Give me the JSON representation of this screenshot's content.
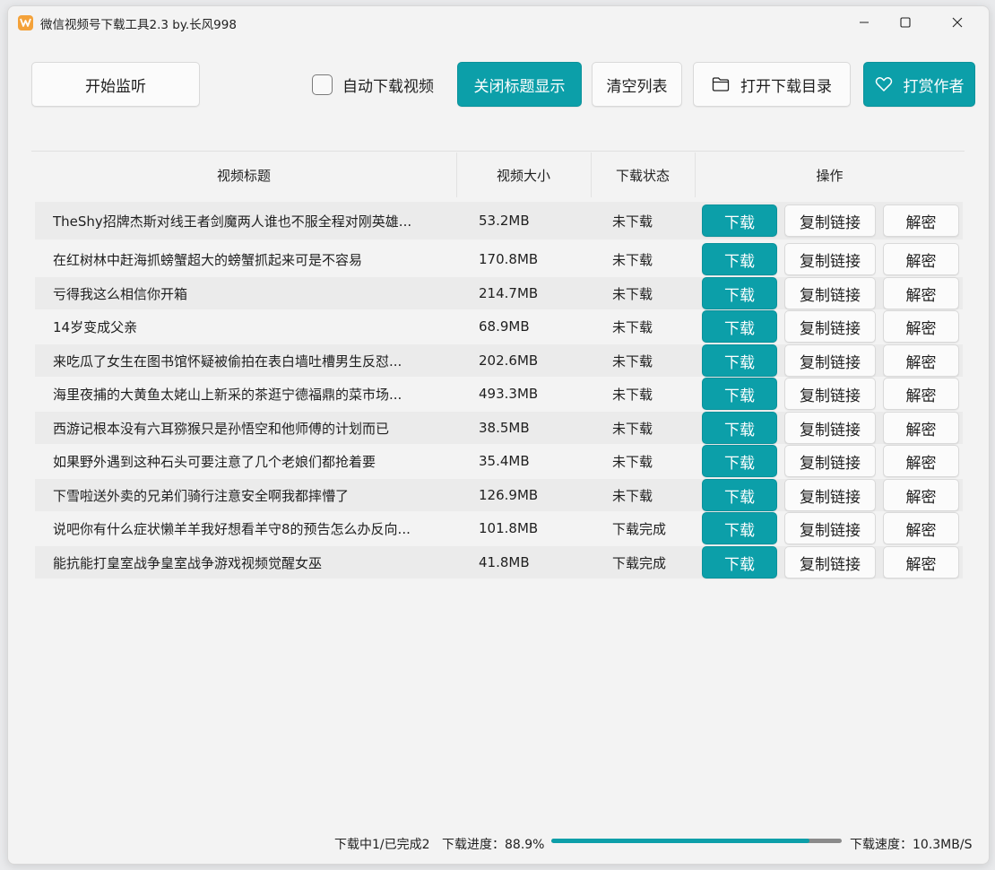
{
  "window": {
    "title": "微信视频号下载工具2.3 by.长风998"
  },
  "toolbar": {
    "start_listen": "开始监听",
    "auto_download": "自动下载视频",
    "auto_download_checked": false,
    "toggle_title": "关闭标题显示",
    "clear_list": "清空列表",
    "open_dir": "打开下载目录",
    "tip_author": "打赏作者"
  },
  "table": {
    "headers": [
      "视频标题",
      "视频大小",
      "下载状态",
      "操作"
    ],
    "action_labels": {
      "download": "下载",
      "copy_link": "复制链接",
      "decrypt": "解密"
    },
    "rows": [
      {
        "title": "TheShy招牌杰斯对线王者剑魔两人谁也不服全程对刚英雄...",
        "size": "53.2MB",
        "status": "未下载"
      },
      {
        "title": "在红树林中赶海抓螃蟹超大的螃蟹抓起来可是不容易",
        "size": "170.8MB",
        "status": "未下载"
      },
      {
        "title": "亏得我这么相信你开箱",
        "size": "214.7MB",
        "status": "未下载"
      },
      {
        "title": "14岁变成父亲",
        "size": "68.9MB",
        "status": "未下载"
      },
      {
        "title": "来吃瓜了女生在图书馆怀疑被偷拍在表白墙吐槽男生反怼...",
        "size": "202.6MB",
        "status": "未下载"
      },
      {
        "title": "海里夜捕的大黄鱼太姥山上新采的茶逛宁德福鼎的菜市场...",
        "size": "493.3MB",
        "status": "未下载"
      },
      {
        "title": "西游记根本没有六耳猕猴只是孙悟空和他师傅的计划而已",
        "size": "38.5MB",
        "status": "未下载"
      },
      {
        "title": "如果野外遇到这种石头可要注意了几个老娘们都抢着要",
        "size": "35.4MB",
        "status": "未下载"
      },
      {
        "title": "下雪啦送外卖的兄弟们骑行注意安全啊我都摔懵了",
        "size": "126.9MB",
        "status": "未下载"
      },
      {
        "title": "说吧你有什么症状懒羊羊我好想看羊守8的预告怎么办反向...",
        "size": "101.8MB",
        "status": "下载完成"
      },
      {
        "title": "能抗能打皇室战争皇室战争游戏视频觉醒女巫",
        "size": "41.8MB",
        "status": "下载完成"
      }
    ]
  },
  "statusbar": {
    "counts": "下载中1/已完成2",
    "progress_label": "下载进度：88.9%",
    "progress_value": 0.889,
    "speed": "下载速度：10.3MB/S"
  },
  "colors": {
    "accent": "#0c9fa9",
    "app_icon": "#f4a23a"
  },
  "icons": [
    "app-logo-icon",
    "minimize-icon",
    "maximize-icon",
    "close-icon",
    "folder-icon",
    "heart-icon"
  ]
}
